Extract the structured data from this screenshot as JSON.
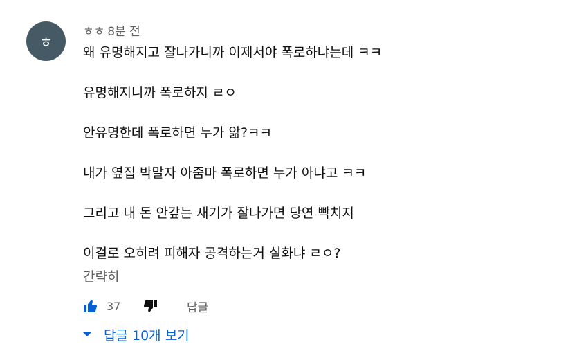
{
  "comment": {
    "avatar_initial": "ㅎ",
    "author": "ㅎㅎ",
    "timestamp": "8분 전",
    "lines": [
      "왜 유명해지고 잘나가니까 이제서야 폭로하냐는데 ㅋㅋ",
      "유명해지니까 폭로하지 ㄹㅇ",
      "안유명한데 폭로하면 누가 앎?ㅋㅋ",
      "내가 옆집 박말자 아줌마 폭로하면 누가 아냐고 ㅋㅋ",
      "그리고 내 돈 안갚는 새기가 잘나가면 당연 빡치지",
      "이걸로 오히려 피해자 공격하는거 실화냐 ㄹㅇ?"
    ],
    "collapse_label": "간략히"
  },
  "actions": {
    "like_icon": "thumbs-up-icon",
    "like_count": "37",
    "dislike_icon": "thumbs-down-icon",
    "reply_label": "답글"
  },
  "replies": {
    "toggle_icon": "caret-down-icon",
    "label": "답글 10개 보기"
  },
  "colors": {
    "avatar_bg": "#455a64",
    "secondary_text": "#606060",
    "link_blue": "#065fd4",
    "like_active": "#065fd4"
  }
}
